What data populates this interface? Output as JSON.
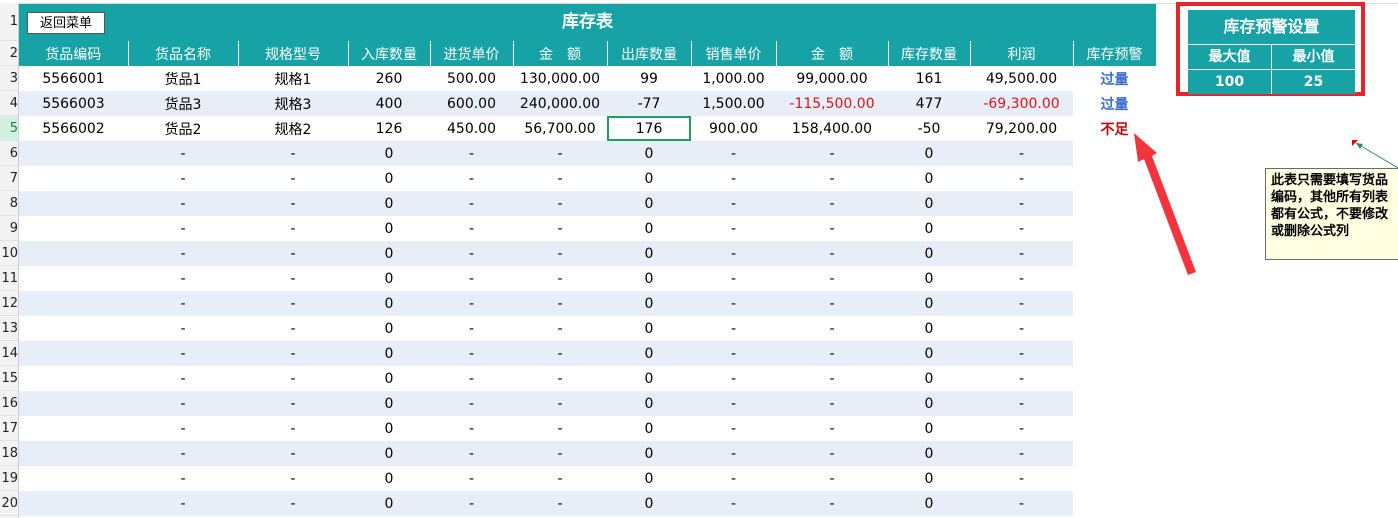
{
  "sheet": {
    "title": "库存表",
    "back_button": "返回菜单",
    "row_numbers": [
      "1",
      "2",
      "3",
      "4",
      "5",
      "6",
      "7",
      "8",
      "9",
      "10",
      "11",
      "12",
      "13",
      "14",
      "15",
      "16",
      "17",
      "18",
      "19",
      "20"
    ],
    "headers": [
      "货品编码",
      "货品名称",
      "规格型号",
      "入库数量",
      "进货单价",
      "金　额",
      "出库数量",
      "销售单价",
      "金　额",
      "库存数量",
      "利润",
      "库存预警"
    ],
    "rows": [
      [
        "5566001",
        "货品1",
        "规格1",
        "260",
        "500.00",
        "130,000.00",
        "99",
        "1,000.00",
        "99,000.00",
        "161",
        "49,500.00",
        "过量"
      ],
      [
        "5566003",
        "货品3",
        "规格3",
        "400",
        "600.00",
        "240,000.00",
        "-77",
        "1,500.00",
        "-115,500.00",
        "477",
        "-69,300.00",
        "过量"
      ],
      [
        "5566002",
        "货品2",
        "规格2",
        "126",
        "450.00",
        "56,700.00",
        "176",
        "900.00",
        "158,400.00",
        "-50",
        "79,200.00",
        "不足"
      ],
      [
        "",
        "-",
        "-",
        "0",
        "-",
        "-",
        "0",
        "-",
        "-",
        "0",
        "-",
        ""
      ],
      [
        "",
        "-",
        "-",
        "0",
        "-",
        "-",
        "0",
        "-",
        "-",
        "0",
        "-",
        ""
      ],
      [
        "",
        "-",
        "-",
        "0",
        "-",
        "-",
        "0",
        "-",
        "-",
        "0",
        "-",
        ""
      ],
      [
        "",
        "-",
        "-",
        "0",
        "-",
        "-",
        "0",
        "-",
        "-",
        "0",
        "-",
        ""
      ],
      [
        "",
        "-",
        "-",
        "0",
        "-",
        "-",
        "0",
        "-",
        "-",
        "0",
        "-",
        ""
      ],
      [
        "",
        "-",
        "-",
        "0",
        "-",
        "-",
        "0",
        "-",
        "-",
        "0",
        "-",
        ""
      ],
      [
        "",
        "-",
        "-",
        "0",
        "-",
        "-",
        "0",
        "-",
        "-",
        "0",
        "-",
        ""
      ],
      [
        "",
        "-",
        "-",
        "0",
        "-",
        "-",
        "0",
        "-",
        "-",
        "0",
        "-",
        ""
      ],
      [
        "",
        "-",
        "-",
        "0",
        "-",
        "-",
        "0",
        "-",
        "-",
        "0",
        "-",
        ""
      ],
      [
        "",
        "-",
        "-",
        "0",
        "-",
        "-",
        "0",
        "-",
        "-",
        "0",
        "-",
        ""
      ],
      [
        "",
        "-",
        "-",
        "0",
        "-",
        "-",
        "0",
        "-",
        "-",
        "0",
        "-",
        ""
      ],
      [
        "",
        "-",
        "-",
        "0",
        "-",
        "-",
        "0",
        "-",
        "-",
        "0",
        "-",
        ""
      ],
      [
        "",
        "-",
        "-",
        "0",
        "-",
        "-",
        "0",
        "-",
        "-",
        "0",
        "-",
        ""
      ],
      [
        "",
        "-",
        "-",
        "0",
        "-",
        "-",
        "0",
        "-",
        "-",
        "0",
        "-",
        ""
      ],
      [
        "",
        "-",
        "-",
        "0",
        "-",
        "-",
        "0",
        "-",
        "-",
        "0",
        "-",
        ""
      ]
    ]
  },
  "warning_settings": {
    "title": "库存预警设置",
    "max_label": "最大值",
    "min_label": "最小值",
    "max_value": "100",
    "min_value": "25"
  },
  "note": {
    "text": "此表只需要填写货品编码，其他所有列表都有公式，不要修改或删除公式列"
  },
  "colors": {
    "header_teal": "#17a2a5",
    "stripe_blue": "#e8eef8",
    "negative_red": "#e0101a",
    "over_blue": "#3d6ec8",
    "low_red": "#c80000",
    "highlight_red": "#e8232c"
  }
}
